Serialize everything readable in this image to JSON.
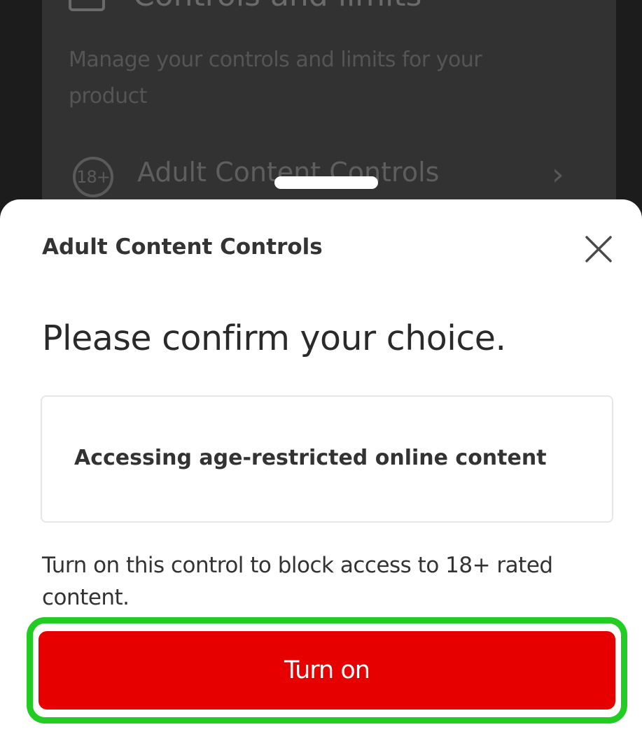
{
  "background": {
    "header_title": "Controls and limits",
    "description": "Manage your controls and limits for your product",
    "row_badge": "18+",
    "row_label": "Adult Content Controls"
  },
  "sheet": {
    "title": "Adult Content Controls",
    "headline": "Please confirm your choice.",
    "option_label": "Accessing age-restricted online content",
    "helper_text": "Turn on this control to block access to 18+ rated content.",
    "primary_button": "Turn on"
  },
  "colors": {
    "primary": "#e60000",
    "highlight": "#22cc22",
    "overlay": "#1f1f1f"
  },
  "icons": {
    "close": "close-icon",
    "chevron": "chevron-right-icon",
    "header": "controls-icon"
  }
}
